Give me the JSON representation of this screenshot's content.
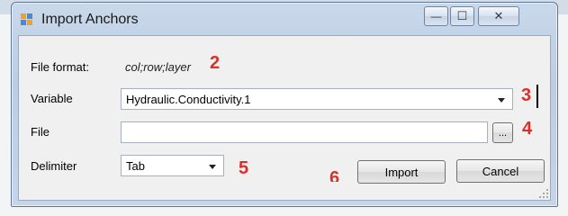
{
  "window": {
    "title": "Import Anchors",
    "buttons": {
      "minimize": "—",
      "maximize": "☐",
      "close": "✕"
    }
  },
  "form": {
    "file_format_label": "File format:",
    "file_format_value": "col;row;layer",
    "variable_label": "Variable",
    "variable_value": "Hydraulic.Conductivity.1",
    "file_label": "File",
    "file_value": "",
    "browse_label": "...",
    "delimiter_label": "Delimiter",
    "delimiter_value": "Tab"
  },
  "buttons": {
    "import": "Import",
    "cancel": "Cancel"
  },
  "annotations": [
    "2",
    "3",
    "4",
    "5",
    "6"
  ],
  "colors": {
    "annotation": "#d9302a",
    "titlebar": "#c9d8ea",
    "client": "#f0f0f0"
  }
}
